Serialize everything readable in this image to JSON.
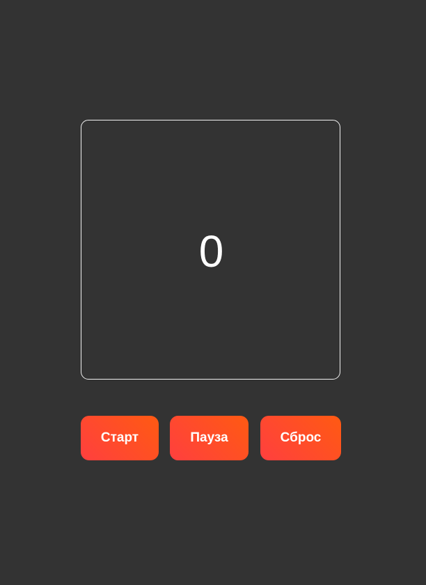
{
  "timer": {
    "value": "0"
  },
  "controls": {
    "start_label": "Старт",
    "pause_label": "Пауза",
    "reset_label": "Сброс"
  },
  "colors": {
    "background": "#333333",
    "display_border": "#f2f2f2",
    "button_gradient_start": "#ff3f3f",
    "button_gradient_end": "#ff5a12",
    "text": "#ffffff"
  }
}
